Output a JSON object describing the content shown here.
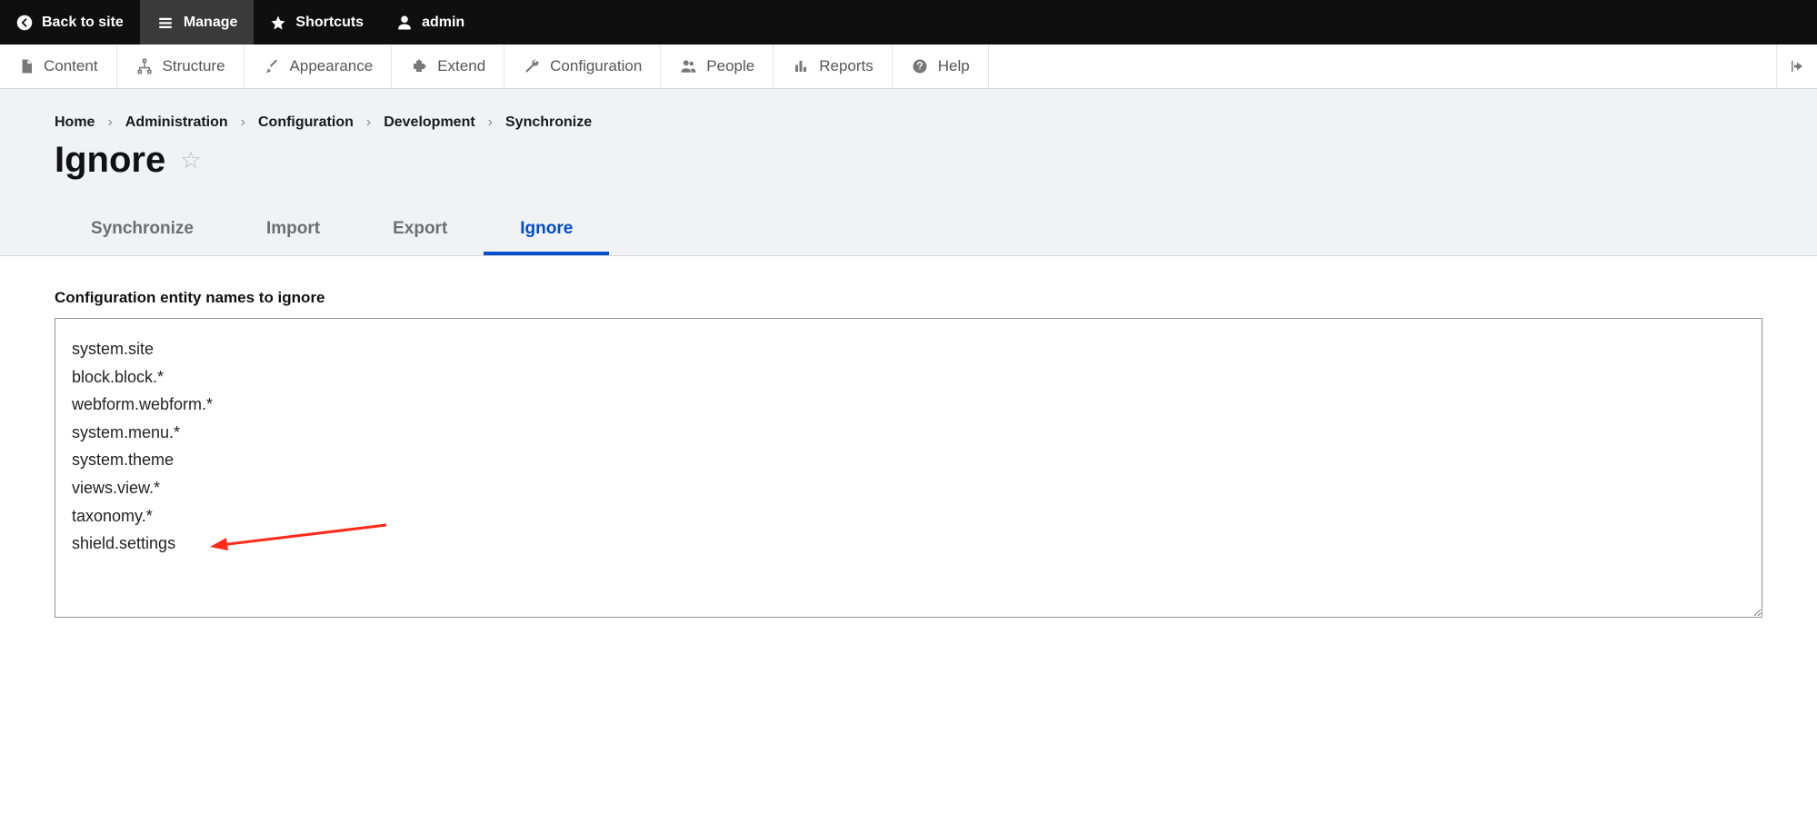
{
  "toolbar_top": {
    "back": "Back to site",
    "manage": "Manage",
    "shortcuts": "Shortcuts",
    "user": "admin"
  },
  "toolbar_admin": {
    "content": "Content",
    "structure": "Structure",
    "appearance": "Appearance",
    "extend": "Extend",
    "configuration": "Configuration",
    "people": "People",
    "reports": "Reports",
    "help": "Help"
  },
  "breadcrumb": {
    "items": [
      "Home",
      "Administration",
      "Configuration",
      "Development",
      "Synchronize"
    ]
  },
  "page_title": "Ignore",
  "tabs": {
    "synchronize": "Synchronize",
    "import": "Import",
    "export": "Export",
    "ignore": "Ignore"
  },
  "form": {
    "label": "Configuration entity names to ignore",
    "value": "system.site\nblock.block.*\nwebform.webform.*\nsystem.menu.*\nsystem.theme\nviews.view.*\ntaxonomy.*\nshield.settings"
  }
}
